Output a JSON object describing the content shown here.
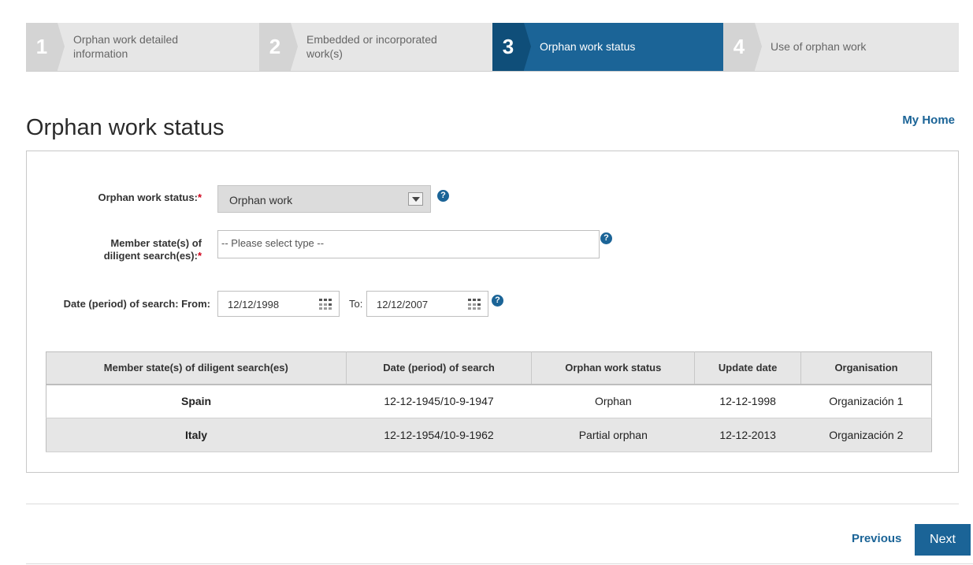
{
  "wizard": {
    "steps": [
      {
        "number": "1",
        "label": "Orphan work detailed information"
      },
      {
        "number": "2",
        "label": "Embedded or incorporated work(s)"
      },
      {
        "number": "3",
        "label": "Orphan work status"
      },
      {
        "number": "4",
        "label": "Use of orphan work"
      }
    ],
    "active_step": 3
  },
  "header": {
    "title": "Orphan work status",
    "my_home": "My Home"
  },
  "form": {
    "status_label": "Orphan work status:",
    "status_value": "Orphan work",
    "member_states_label_line1": "Member state(s) of",
    "member_states_label_line2": "diligent search(es):",
    "member_states_placeholder": "-- Please select type --",
    "date_label": "Date (period) of search: From:",
    "date_from": "12/12/1998",
    "to_label": "To:",
    "date_to": "12/12/2007",
    "required_mark": "*",
    "help_glyph": "?"
  },
  "table": {
    "headers": [
      "Member state(s) of diligent search(es)",
      "Date (period) of search",
      "Orphan work status",
      "Update date",
      "Organisation"
    ],
    "rows": [
      [
        "Spain",
        "12-12-1945/10-9-1947",
        "Orphan",
        "12-12-1998",
        "Organización 1"
      ],
      [
        "Italy",
        "12-12-1954/10-9-1962",
        "Partial orphan",
        "12-12-2013",
        "Organización 2"
      ]
    ]
  },
  "footer": {
    "previous": "Previous",
    "next": "Next"
  },
  "colors": {
    "accent": "#1b6497",
    "required": "#d0021b",
    "step_inactive": "#e6e6e6"
  },
  "icons": {
    "help": "help-icon",
    "calendar": "calendar-icon",
    "dropdown": "chevron-down-icon"
  }
}
